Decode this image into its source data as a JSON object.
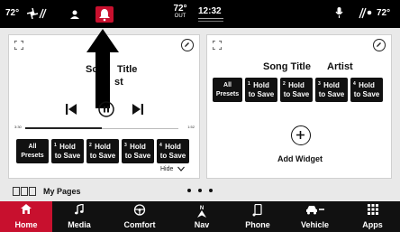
{
  "status_bar": {
    "inside_temp": "72°",
    "outside_temp": "72°",
    "outside_label": "OUT",
    "time": "12:32",
    "right_temp": "72°"
  },
  "media_widget": {
    "song_title": "Song Title",
    "artist": "st",
    "song_title_partial": "So",
    "elapsed": "3:30",
    "duration": "1:52",
    "progress": 0.5,
    "presets": [
      {
        "num": "",
        "line1": "All",
        "line2": "Presets"
      },
      {
        "num": "1",
        "line1": "Hold",
        "line2": "to Save"
      },
      {
        "num": "2",
        "line1": "Hold",
        "line2": "to Save"
      },
      {
        "num": "3",
        "line1": "Hold",
        "line2": "to Save"
      },
      {
        "num": "4",
        "line1": "Hold",
        "line2": "to Save"
      }
    ],
    "hide_label": "Hide"
  },
  "right_widget": {
    "song_title": "Song Title",
    "artist": "Artist",
    "presets": [
      {
        "num": "",
        "line1": "All",
        "line2": "Presets"
      },
      {
        "num": "1",
        "line1": "Hold",
        "line2": "to Save"
      },
      {
        "num": "2",
        "line1": "Hold",
        "line2": "to Save"
      },
      {
        "num": "3",
        "line1": "Hold",
        "line2": "to Save"
      },
      {
        "num": "4",
        "line1": "Hold",
        "line2": "to Save"
      }
    ],
    "add_widget_label": "Add Widget"
  },
  "my_pages_label": "My Pages",
  "nav": [
    {
      "label": "Home",
      "icon": "home-icon",
      "active": true
    },
    {
      "label": "Media",
      "icon": "music-note-icon",
      "active": false
    },
    {
      "label": "Comfort",
      "icon": "steering-wheel-icon",
      "active": false
    },
    {
      "label": "Nav",
      "icon": "compass-icon",
      "active": false
    },
    {
      "label": "Phone",
      "icon": "phone-icon",
      "active": false
    },
    {
      "label": "Vehicle",
      "icon": "car-icon",
      "active": false
    },
    {
      "label": "Apps",
      "icon": "apps-grid-icon",
      "active": false
    }
  ],
  "colors": {
    "accent": "#c8102e",
    "nav_bg": "#111111",
    "content_bg": "#e9e9e9"
  }
}
